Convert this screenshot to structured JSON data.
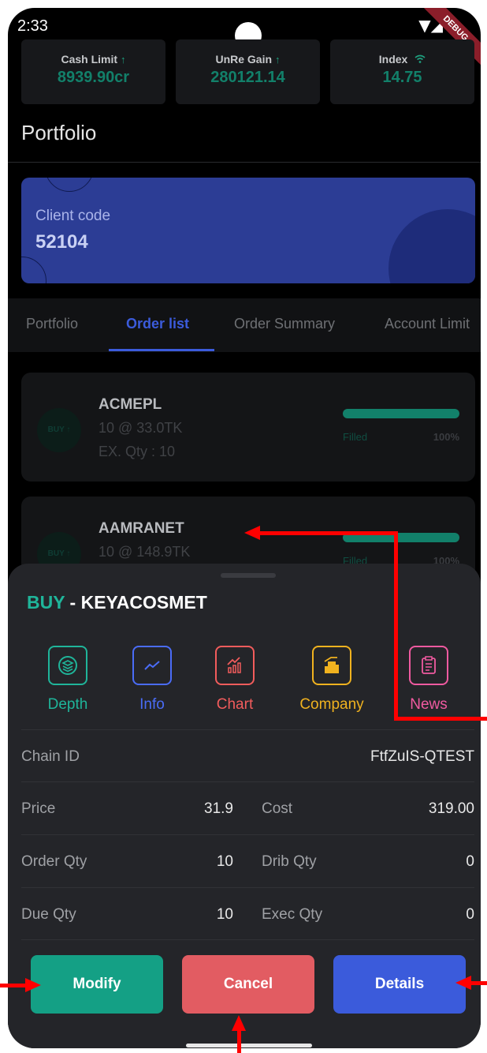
{
  "status_bar": {
    "time": "2:33",
    "debug_label": "DEBUG"
  },
  "stats": [
    {
      "label": "Cash Limit",
      "value": "8939.90cr",
      "icon": "arrow-up-icon"
    },
    {
      "label": "UnRe Gain",
      "value": "280121.14",
      "icon": "arrow-up-icon"
    },
    {
      "label": "Index",
      "value": "14.75",
      "icon": "wifi-icon"
    }
  ],
  "page_title": "Portfolio",
  "client": {
    "label": "Client code",
    "code": "52104"
  },
  "tabs": [
    {
      "label": "Portfolio"
    },
    {
      "label": "Order list"
    },
    {
      "label": "Order Summary"
    },
    {
      "label": "Account Limit"
    }
  ],
  "orders": [
    {
      "side": "BUY ↑",
      "symbol": "ACMEPL",
      "detail": "10 @ 33.0TK",
      "exec_qty": "EX. Qty : 10",
      "status": "Filled",
      "percent": "100%",
      "progress": 1.0
    },
    {
      "side": "BUY ↑",
      "symbol": "AAMRANET",
      "detail": "10 @ 148.9TK",
      "status": "Filled",
      "percent": "100%",
      "progress": 1.0
    }
  ],
  "sheet": {
    "side": "BUY",
    "separator": " - ",
    "symbol": "KEYACOSMET",
    "actions": [
      {
        "label": "Depth",
        "icon": "layers-icon",
        "color": "#1fb59a"
      },
      {
        "label": "Info",
        "icon": "line-chart-icon",
        "color": "#4a6cf7"
      },
      {
        "label": "Chart",
        "icon": "bar-chart-icon",
        "color": "#f25c5c"
      },
      {
        "label": "Company",
        "icon": "building-icon",
        "color": "#f0b21f"
      },
      {
        "label": "News",
        "icon": "newspaper-icon",
        "color": "#f05aa0"
      }
    ],
    "chain": {
      "label": "Chain ID",
      "value": "FtfZuIS-QTEST"
    },
    "price": {
      "label": "Price",
      "value": "31.9"
    },
    "cost": {
      "label": "Cost",
      "value": "319.00"
    },
    "order_qty": {
      "label": "Order Qty",
      "value": "10"
    },
    "drib_qty": {
      "label": "Drib Qty",
      "value": "0"
    },
    "due_qty": {
      "label": "Due Qty",
      "value": "10"
    },
    "exec_qty": {
      "label": "Exec Qty",
      "value": "0"
    },
    "buttons": {
      "modify": {
        "label": "Modify",
        "color": "#14a085"
      },
      "cancel": {
        "label": "Cancel",
        "color": "#e25c62"
      },
      "details": {
        "label": "Details",
        "color": "#3b5bdb"
      }
    }
  },
  "colors": {
    "accent_green": "#1fb59a",
    "accent_blue": "#3b5bdb",
    "annotation_red": "#ff0000"
  }
}
